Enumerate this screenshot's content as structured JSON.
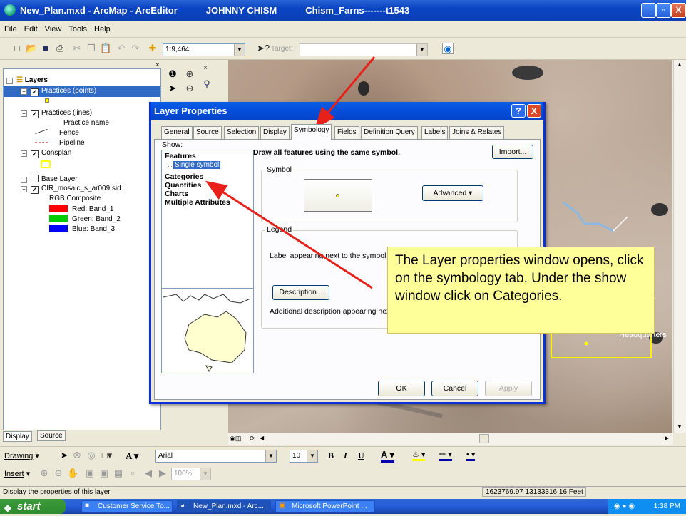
{
  "window": {
    "title": "New_Plan.mxd - ArcMap - ArcEditor",
    "user": "JOHNNY CHISM",
    "project": "Chism_Farns-------t1543",
    "min_label": "_",
    "max_label": "▫",
    "close_label": "X"
  },
  "menu": [
    "File",
    "Edit",
    "View",
    "Tools",
    "Help"
  ],
  "toolbar": {
    "scale": "1:9,464",
    "target_label": "Target:",
    "target_value": ""
  },
  "toc": {
    "root": "Layers",
    "layers": [
      {
        "name": "Practices (points)",
        "checked": true,
        "selected": true
      },
      {
        "name": "Practices (lines)",
        "checked": true
      },
      {
        "name": "Practice name"
      },
      {
        "name": "Fence"
      },
      {
        "name": "Pipeline"
      },
      {
        "name": "Consplan",
        "checked": true
      },
      {
        "name": "Base Layer",
        "checked": false
      },
      {
        "name": "CIR_mosaic_s_ar009.sid",
        "checked": true
      },
      {
        "name": "RGB Composite"
      },
      {
        "name": "Red:   Band_1",
        "color": "#ff0000"
      },
      {
        "name": "Green: Band_2",
        "color": "#00cc00"
      },
      {
        "name": "Blue:  Band_3",
        "color": "#0000ff"
      }
    ],
    "tabs": [
      "Display",
      "Source"
    ]
  },
  "dialog": {
    "title": "Layer Properties",
    "help_label": "?",
    "close_label": "X",
    "tabs": [
      "General",
      "Source",
      "Selection",
      "Display",
      "Symbology",
      "Fields",
      "Definition Query",
      "Labels",
      "Joins & Relates"
    ],
    "active_tab": "Symbology",
    "show_label": "Show:",
    "show_items": [
      "Features",
      "Single symbol",
      "Categories",
      "Quantities",
      "Charts",
      "Multiple Attributes"
    ],
    "heading": "Draw all features using the same symbol.",
    "import_label": "Import...",
    "symbol_group": "Symbol",
    "advanced_label": "Advanced",
    "legend_group": "Legend",
    "legend_text": "Label appearing next to the symbol in",
    "description_label": "Description...",
    "additional_text": "Additional description appearing next",
    "ok_label": "OK",
    "cancel_label": "Cancel",
    "apply_label": "Apply"
  },
  "callout": "The Layer properties window opens, click on the symbology tab. Under the show window click on Categories.",
  "drawing_bar": {
    "drawing_label": "Drawing",
    "font": "Arial",
    "size": "10",
    "bold": "B",
    "italic": "I",
    "underline": "U",
    "text_A": "A"
  },
  "insert_bar": {
    "insert_label": "Insert",
    "zoom": "100%"
  },
  "status": {
    "message": "Display the properties of this layer",
    "coords": "1623769.97  13133316.16 Feet"
  },
  "taskbar": {
    "start": "start",
    "tasks": [
      "Customer Service To...",
      "New_Plan.mxd - Arc...",
      "Microsoft PowerPoint ..."
    ],
    "time": "1:38 PM"
  },
  "map_label": "Headquarters",
  "colors": {
    "titlebar": "#0a44c2",
    "selection": "#316ac5",
    "callout": "#ffff99",
    "arrow": "#e8201a"
  }
}
